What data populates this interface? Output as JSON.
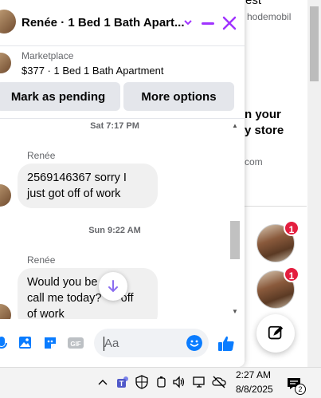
{
  "background": {
    "top_text_1": "Invest",
    "top_text_2": "hodemobil",
    "body_text_1": "n your",
    "body_text_2": "y store",
    "domain_text": "com"
  },
  "contacts": [
    {
      "badge": "1"
    },
    {
      "badge": "1"
    }
  ],
  "chat": {
    "title": "Renée · 1 Bed 1 Bath Apart...",
    "marketplace_label": "Marketplace",
    "listing": "$377 · 1 Bed 1 Bath Apartment",
    "mark_pending_label": "Mark as pending",
    "more_options_label": "More options",
    "messages": [
      {
        "timestamp": "Sat 7:17 PM",
        "sender": "Renée",
        "text_line_1": "2569146367 sorry I",
        "text_line_2": "just got off of work"
      },
      {
        "timestamp": "Sun 9:22 AM",
        "sender": "Renée",
        "text_line_1": "Would you be      to",
        "text_line_2": "call me today?      off",
        "text_line_3": "of work"
      }
    ],
    "composer_placeholder": "Aa"
  },
  "taskbar": {
    "time": "2:27 AM",
    "date": "8/8/2025",
    "notification_count": "2"
  },
  "colors": {
    "accent": "#a033ff",
    "messenger_blue": "#0a7cff",
    "badge_red": "#e41e3f"
  }
}
